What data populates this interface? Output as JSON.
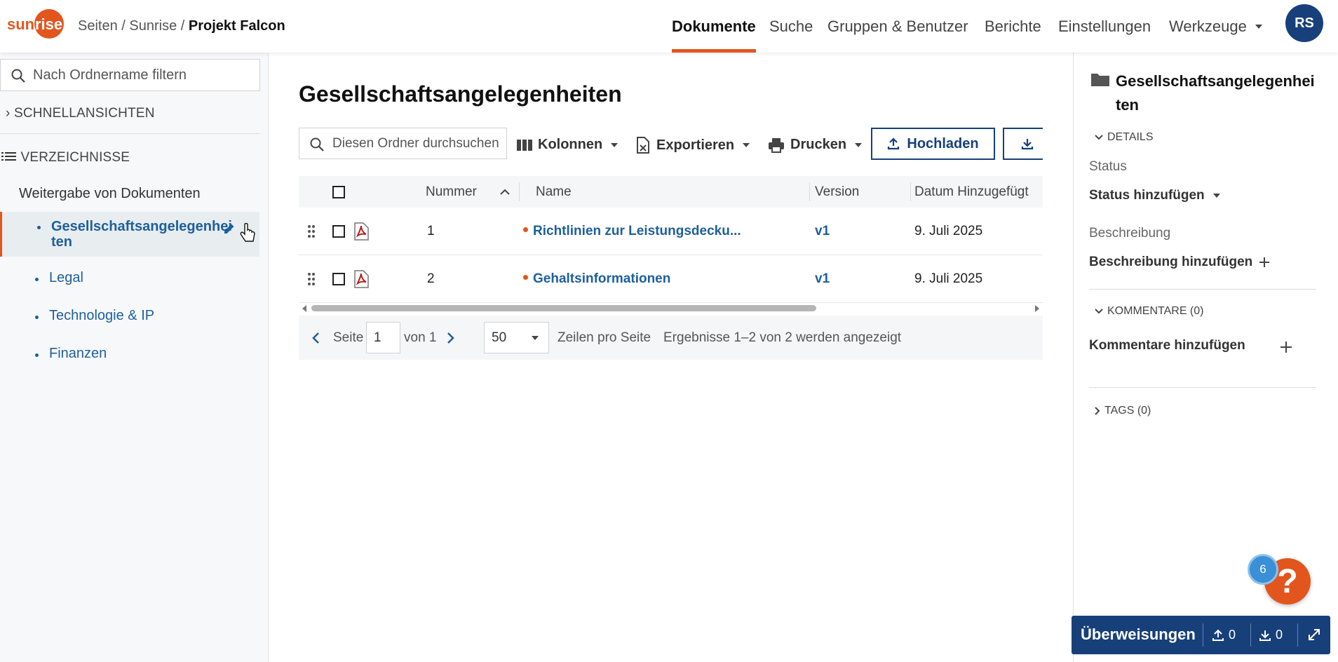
{
  "header": {
    "logo_text": "sunrise",
    "breadcrumb": {
      "seiten": "Seiten",
      "sep": " / ",
      "sunrise": "Sunrise",
      "project": "Projekt Falcon"
    },
    "nav": [
      {
        "label": "Dokumente",
        "active": true
      },
      {
        "label": "Suche"
      },
      {
        "label": "Gruppen & Benutzer"
      },
      {
        "label": "Berichte"
      },
      {
        "label": "Einstellungen"
      },
      {
        "label": "Werkzeuge"
      }
    ],
    "avatar_initials": "RS"
  },
  "sidebar": {
    "filter_placeholder": "Nach Ordnername filtern",
    "quick_views": "SCHNELLANSICHTEN",
    "directories": "VERZEICHNISSE",
    "root": "Weitergabe von Dokumenten",
    "items": [
      {
        "label_line1": "Gesellschaftsangelegenhei",
        "label_line2": "ten"
      },
      {
        "label": "Legal"
      },
      {
        "label": "Technologie & IP"
      },
      {
        "label": "Finanzen"
      }
    ]
  },
  "main": {
    "title": "Gesellschaftsangelegenheiten",
    "search_placeholder": "Diesen Ordner durchsuchen",
    "toolbar": {
      "columns": "Kolonnen",
      "export": "Exportieren",
      "print": "Drucken",
      "upload": "Hochladen"
    },
    "table": {
      "headers": {
        "number": "Nummer",
        "name": "Name",
        "version": "Version",
        "date_added": "Datum Hinzugefügt"
      },
      "rows": [
        {
          "number": "1",
          "name": "Richtlinien zur Leistungsdecku...",
          "version": "v1",
          "date": "9. Juli 2025"
        },
        {
          "number": "2",
          "name": "Gehaltsinformationen",
          "version": "v1",
          "date": "9. Juli 2025"
        }
      ]
    },
    "pager": {
      "page_label": "Seite",
      "page_value": "1",
      "of_label": "von 1",
      "rows_value": "50",
      "rows_label": "Zeilen pro Seite",
      "results": "Ergebnisse 1–2 von 2 werden angezeigt"
    }
  },
  "details": {
    "title_line1": "Gesellschaftsangelegenhei",
    "title_line2": "ten",
    "details_label": "DETAILS",
    "status_label": "Status",
    "status_value": "Status hinzufügen",
    "description_label": "Beschreibung",
    "description_value": "Beschreibung hinzufügen",
    "comments_label": "KOMMENTARE (0)",
    "comments_value": "Kommentare hinzufügen",
    "tags_label": "TAGS (0)"
  },
  "help": {
    "badge_count": "6",
    "icon": "?"
  },
  "transfers": {
    "label": "Überweisungen",
    "uploads": "0",
    "downloads": "0"
  },
  "colors": {
    "accent": "#e2561e",
    "brand": "#17407b",
    "link": "#1e5f9c"
  }
}
